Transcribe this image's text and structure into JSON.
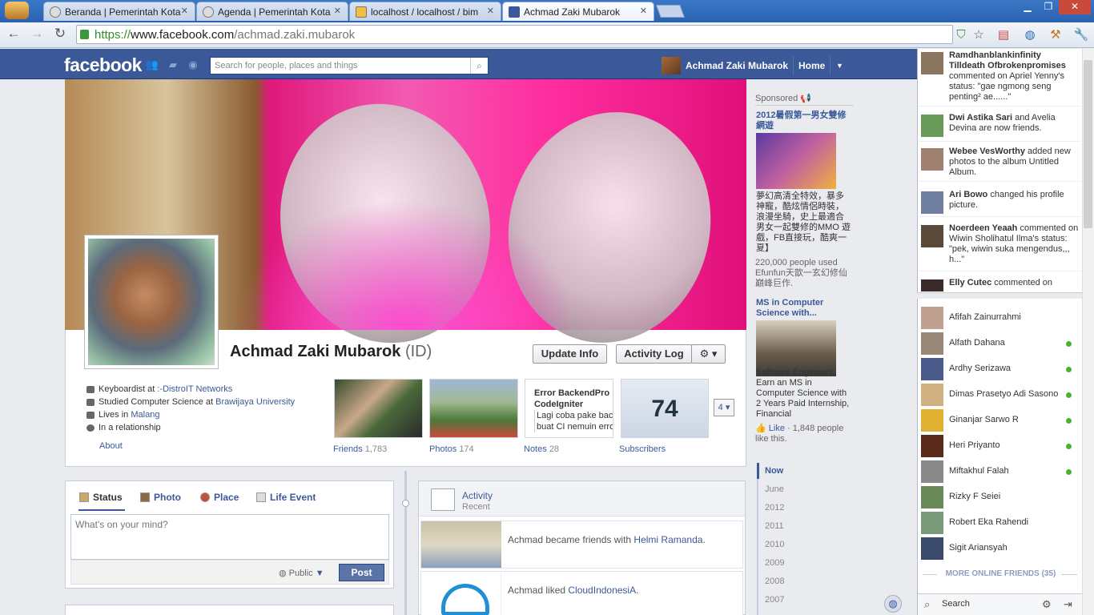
{
  "browser": {
    "tabs": [
      {
        "title": "Beranda | Pemerintah Kota",
        "active": false
      },
      {
        "title": "Agenda | Pemerintah Kota",
        "active": false
      },
      {
        "title": "localhost / localhost / bim",
        "active": false
      },
      {
        "title": "Achmad Zaki Mubarok",
        "active": true
      }
    ],
    "url_protocol": "https://",
    "url_host": "www.facebook.com",
    "url_path": "/achmad.zaki.mubarok"
  },
  "fb": {
    "logo": "facebook",
    "search_placeholder": "Search for people, places and things",
    "nav_user": "Achmad Zaki Mubarok",
    "nav_home": "Home"
  },
  "profile": {
    "name": "Achmad Zaki Mubarok",
    "alt_name": "(ID)",
    "update_info": "Update Info",
    "activity_log": "Activity Log",
    "info": [
      {
        "prefix": "Keyboardist at ",
        "link": ":-DistroIT Networks"
      },
      {
        "prefix": "Studied Computer Science at ",
        "link": "Brawijaya University"
      },
      {
        "prefix": "Lives in ",
        "link": "Malang"
      },
      {
        "prefix": "In a relationship",
        "link": ""
      }
    ],
    "about": "About",
    "tiles": {
      "friends_label": "Friends",
      "friends_count": "1,783",
      "photos_label": "Photos",
      "photos_count": "174",
      "notes_label": "Notes",
      "notes_count": "28",
      "notes_title": "Error BackendPro CodeIgniter",
      "notes_body1": "Lagi coba pake backe",
      "notes_body2": "buat CI nemuin error",
      "subs_label": "Subscribers",
      "subs_count": "74",
      "more": "4"
    }
  },
  "composer": {
    "tabs": [
      "Status",
      "Photo",
      "Place",
      "Life Event"
    ],
    "placeholder": "What's on your mind?",
    "privacy": "Public",
    "post": "Post"
  },
  "activity": {
    "title": "Activity",
    "subtitle": "Recent",
    "items": [
      {
        "prefix": "Achmad became friends with ",
        "link": "Helmi Ramanda",
        "suffix": "."
      },
      {
        "prefix": "Achmad liked ",
        "link": "CloudIndonesiA",
        "suffix": "."
      }
    ]
  },
  "sponsored": {
    "header": "Sponsored",
    "ad1_title": "2012暑假第一男女雙修網遊",
    "ad1_body": "夢幻高清全特效，暴多神寵，酷炫情侶時裝，浪漫坐騎，史上最適合男女一起雙修的MMO 遊戲，FB直接玩，酷爽一夏】",
    "ad1_small": "220,000 people used Efunfun天歆一玄幻修仙巔峰巨作.",
    "ad2_title": "MS in Computer Science with...",
    "ad2_body": "Software Engineers: Earn an MS in Computer Science with 2 Years Paid Internship, Financial",
    "ad2_like": "Like",
    "ad2_likes": " · 1,848 people like this."
  },
  "timeline_years": [
    "Now",
    "June",
    "2012",
    "2011",
    "2010",
    "2009",
    "2008",
    "2007"
  ],
  "ticker": [
    {
      "name": "Ramdhanblankinfinity Tilldeath Ofbrokenpromises",
      "text": " commented on Apriel Yenny's status: \"gae ngmong seng penting² ae......\""
    },
    {
      "name": "Dwi Astika Sari",
      "text": " and Avelia Devina are now friends."
    },
    {
      "name": "Webee VesWorthy",
      "text": " added new photos to the album Untitled Album."
    },
    {
      "name": "Ari Bowo",
      "text": " changed his profile picture."
    },
    {
      "name": "Noerdeen Yeaah",
      "text": " commented on Wiwin Sholihatul Ilma's status: \"pek, wiwin suka mengendus,,, h...\""
    },
    {
      "name": "Elly Cutec",
      "text": " commented on"
    }
  ],
  "chat": {
    "friends": [
      {
        "name": "Afifah Zainurrahmi",
        "online": false
      },
      {
        "name": "Alfath Dahana",
        "online": true
      },
      {
        "name": "Ardhy Serizawa",
        "online": true
      },
      {
        "name": "Dimas Prasetyo Adi Sasono",
        "online": true
      },
      {
        "name": "Ginanjar Sarwo R",
        "online": true
      },
      {
        "name": "Heri Priyanto",
        "online": true
      },
      {
        "name": "Miftakhul Falah",
        "online": true
      },
      {
        "name": "Rizky F Seiei",
        "online": false
      },
      {
        "name": "Robert Eka Rahendi",
        "online": false
      },
      {
        "name": "Sigit Ariansyah",
        "online": false
      }
    ],
    "more_online": "MORE ONLINE FRIENDS (35)",
    "search": "Search"
  },
  "colors": {
    "fb_blue": "#3b5998",
    "online_green": "#42b72a"
  }
}
